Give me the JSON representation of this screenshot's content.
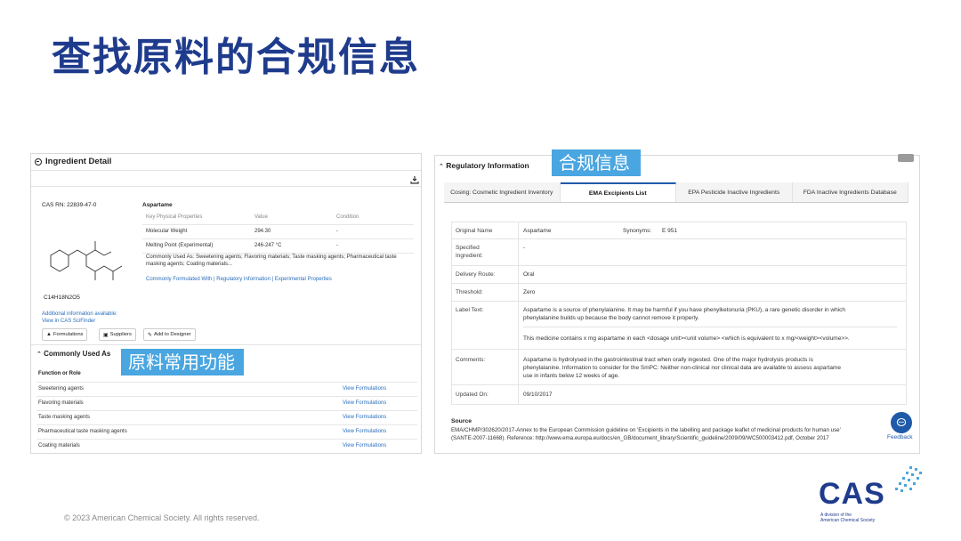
{
  "slide": {
    "title": "查找原料的合规信息",
    "copyright": "© 2023 American Chemical Society. All rights reserved."
  },
  "callouts": {
    "left": "原料常用功能",
    "right": "合规信息"
  },
  "ingredient_detail": {
    "header": "Ingredient Detail",
    "cas_rn": "CAS RN:  22839-47-0",
    "name": "Aspartame",
    "prop_headers": [
      "Key Physical Properties",
      "Value",
      "Condition"
    ],
    "props": [
      {
        "name": "Molecular Weight",
        "value": "294.30",
        "condition": "-"
      },
      {
        "name": "Melting Point (Experimental)",
        "value": "246-247 °C",
        "condition": "-"
      }
    ],
    "commonly_used_as": "Commonly Used As:  Sweetening agents; Flavoring materials; Taste masking agents; Pharmaceutical taste masking agents; Coating materials...",
    "links_line": "Commonly Formulated With | Regulatory Information | Experimental Properties",
    "formula": "C14H18N2O5",
    "additional_info_1": "Additional information available:",
    "additional_info_2": "View in CAS SciFinder",
    "buttons": {
      "formulations": "Formulations",
      "suppliers": "Suppliers",
      "add_to_designer": "Add to Designer"
    },
    "commonly_used_header": "Commonly Used As",
    "function_header": "Function or Role",
    "functions": [
      {
        "name": "Sweetening agents",
        "link": "View Formulations"
      },
      {
        "name": "Flavoring materials",
        "link": "View Formulations"
      },
      {
        "name": "Taste masking agents",
        "link": "View Formulations"
      },
      {
        "name": "Pharmaceutical taste masking agents",
        "link": "View Formulations"
      },
      {
        "name": "Coating materials",
        "link": "View Formulations"
      }
    ]
  },
  "regulatory": {
    "header": "Regulatory Information",
    "tabs": [
      {
        "label": "Cosing: Cosmetic Ingredient Inventory"
      },
      {
        "label": "EMA Excipients List"
      },
      {
        "label": "EPA Pesticide Inactive Ingredients"
      },
      {
        "label": "FDA Inactive Ingredients Database"
      }
    ],
    "rows": {
      "original_name_label": "Original Name",
      "original_name_value": "Aspartame",
      "synonyms_label": "Synonyms:",
      "synonyms_value": "E 951",
      "specified_label_1": "Specified",
      "specified_label_2": "Ingredient:",
      "specified_value": "-",
      "delivery_label": "Delivery Route:",
      "delivery_value": "Oral",
      "threshold_label": "Threshold:",
      "threshold_value": "Zero",
      "label_text_label": "Label Text:",
      "label_text_1": "Aspartame is a source of phenylalanine. It may be harmful if you have phenylketonuria (PKU), a rare genetic disorder in which",
      "label_text_2": "phenylalanine builds up because the body cannot remove it properly.",
      "label_text_3": "This medicine contains x mg aspartame in each <dosage unit><unit volume> <which is equivalent to x mg/<weight><volume>>.",
      "comments_label": "Comments:",
      "comments_1": "Aspartame is hydrolysed in the gastrointestinal tract when orally ingested. One of the major hydrolysis products is",
      "comments_2": "phenylalanine. Information to consider for the SmPC: Neither non-clinical nor clinical data are available to assess aspartame",
      "comments_3": "use in infants below 12 weeks of age.",
      "updated_label": "Updated On:",
      "updated_value": "09/10/2017"
    },
    "source_label": "Source",
    "source_1": "EMA/CHMP/302620/2017-Annex to the European Commission guideline on 'Excipients in the labelling and package leaflet of medicinal products for human use'",
    "source_2": "(SANTE-2007-11668). Reference: http://www.ema.europa.eu/docs/en_GB/document_library/Scientific_guideline/2009/09/WC500003412.pdf, October 2017",
    "feedback": "Feedback"
  },
  "logo": {
    "word": "CAS",
    "tag_1": "A division of the",
    "tag_2": "American Chemical Society"
  },
  "colors": {
    "title": "#1f3b8c",
    "callout": "#4aa6e0",
    "link": "#2a6ebb",
    "accent": "#1f5aa8"
  }
}
